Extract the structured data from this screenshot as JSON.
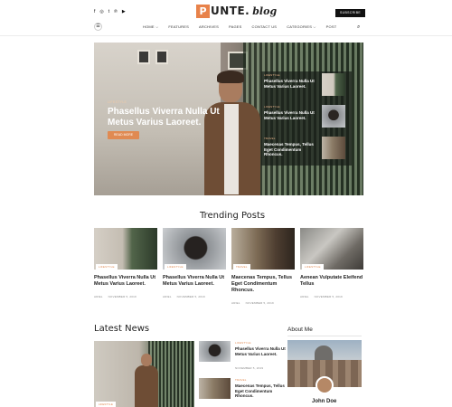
{
  "header": {
    "social_icons": [
      "f",
      "◎",
      "t",
      "℗",
      "▶"
    ],
    "logo_letter": "P",
    "logo_text": "UNTE.",
    "logo_script": "blog",
    "subscribe_label": "SUBSCRIBE",
    "menu_icon": "☰",
    "search_icon": "⌕",
    "nav": [
      {
        "label": "HOME ⌵"
      },
      {
        "label": "FEATURES"
      },
      {
        "label": "ARCHIVES"
      },
      {
        "label": "PAGES"
      },
      {
        "label": "CONTACT US"
      },
      {
        "label": "CATEGORIES ⌵"
      },
      {
        "label": "POST"
      }
    ]
  },
  "hero": {
    "tag": "LIFESTYLE",
    "title": "Phasellus Viverra Nulla Ut Metus Varius Laoreet.",
    "button": "READ MORE",
    "side_posts": [
      {
        "tag": "LIFESTYLE",
        "title": "Phasellus Viverra Nulla Ut Metus Varius Laoreet."
      },
      {
        "tag": "LIFESTYLE",
        "title": "Phasellus Viverra Nulla Ut Metus Varius Laoreet."
      },
      {
        "tag": "TRAVEL",
        "title": "Maecenas Tempus, Tellus Eget Condimentum Rhoncus."
      }
    ]
  },
  "trending": {
    "title": "Trending Posts",
    "posts": [
      {
        "tag": "LIFESTYLE",
        "title": "Phasellus Viverra Nulla Ut Metus Varius Laoreet.",
        "author": "ARIEL",
        "date": "NOVEMBER 5, 2019"
      },
      {
        "tag": "LIFESTYLE",
        "title": "Phasellus Viverra Nulla Ut Metus Varius Laoreet.",
        "author": "ARIEL",
        "date": "NOVEMBER 5, 2019"
      },
      {
        "tag": "TRAVEL",
        "title": "Maecenas Tempus, Tellus Eget Condimentum Rhoncus.",
        "author": "ARIEL",
        "date": "NOVEMBER 5, 2019"
      },
      {
        "tag": "LIFESTYLE",
        "title": "Aenean Vulputate Eleifend Tellus",
        "author": "ARIEL",
        "date": "NOVEMBER 5, 2019"
      }
    ]
  },
  "latest": {
    "title": "Latest News",
    "main_tag": "LIFESTYLE",
    "posts": [
      {
        "tag": "LIFESTYLE",
        "title": "Phasellus Viverra Nulla Ut Metus Varius Laoreet.",
        "date": "NOVEMBER 5, 2019"
      },
      {
        "tag": "TRAVEL",
        "title": "Maecenas Tempus, Tellus Eget Condimentum Rhoncus.",
        "date": "NOVEMBER 5, 2019"
      }
    ]
  },
  "about": {
    "title": "About Me",
    "name": "John Doe"
  }
}
